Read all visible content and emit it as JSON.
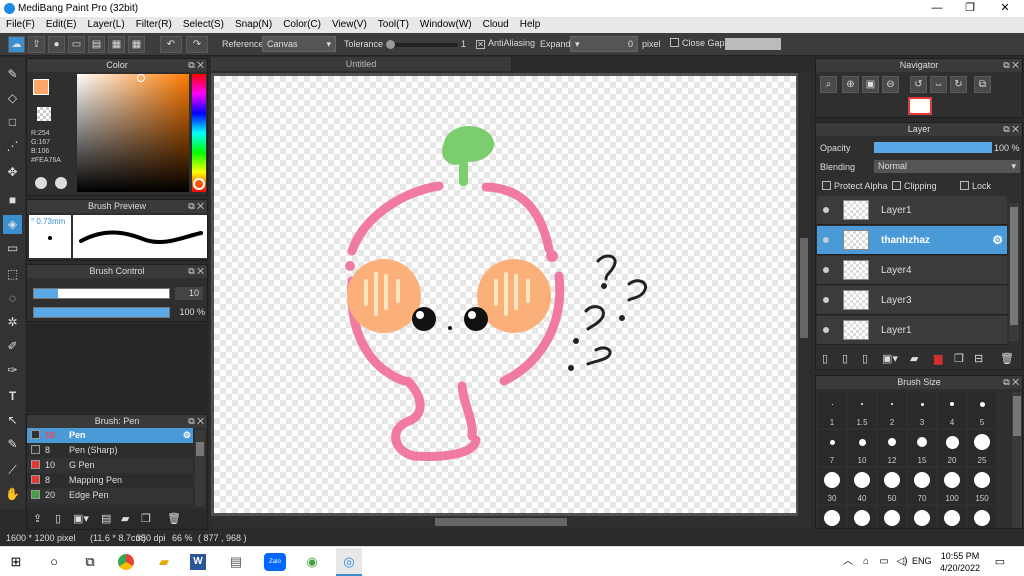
{
  "window": {
    "title": "MediBang Paint Pro (32bit)",
    "minimize": "—",
    "maximize": "❐",
    "close": "✕"
  },
  "menu": [
    "File(F)",
    "Edit(E)",
    "Layer(L)",
    "Filter(R)",
    "Select(S)",
    "Snap(N)",
    "Color(C)",
    "View(V)",
    "Tool(T)",
    "Window(W)",
    "Cloud",
    "Help"
  ],
  "toolbar": {
    "reference_label": "Reference",
    "reference_value": "Canvas",
    "tolerance_label": "Tolerance",
    "tolerance_value": "1",
    "antialiasing_label": "AntiAliasing",
    "antialiasing_checked": "✕",
    "expand_label": "Expand",
    "expand_value": "0",
    "expand_unit": "pixel",
    "close_gaps_label": "Close Gaps"
  },
  "color_panel": {
    "title": "Color",
    "r": "R:254",
    "g": "G:167",
    "b": "B:106",
    "hex": "#FEA76A",
    "primary_color": "#FEA76A"
  },
  "brush_preview": {
    "title": "Brush Preview",
    "size": "° 0.73mm"
  },
  "brush_control": {
    "title": "Brush Control",
    "size_value": "10",
    "opacity_value": "100 %",
    "size_fraction": 0.18,
    "opacity_fraction": 1.0
  },
  "brush_list": {
    "title": "Brush: Pen",
    "items": [
      {
        "size": "10",
        "name": "Pen",
        "color": "#333333",
        "selected": true
      },
      {
        "size": "8",
        "name": "Pen (Sharp)",
        "color": "#333333"
      },
      {
        "size": "10",
        "name": "G Pen",
        "color": "#e53935"
      },
      {
        "size": "8",
        "name": "Mapping Pen",
        "color": "#e53935"
      },
      {
        "size": "20",
        "name": "Edge Pen",
        "color": "#43a047"
      }
    ]
  },
  "canvas": {
    "tab": "Untitled"
  },
  "navigator": {
    "title": "Navigator"
  },
  "layer_panel": {
    "title": "Layer",
    "opacity_label": "Opacity",
    "opacity_value": "100 %",
    "opacity_fraction": 1.0,
    "blending_label": "Blending",
    "blending_value": "Normal",
    "protect_alpha": "Protect Alpha",
    "clipping": "Clipping",
    "lock": "Lock",
    "layers": [
      {
        "name": "Layer1"
      },
      {
        "name": "thanhzhaz",
        "selected": true
      },
      {
        "name": "Layer4"
      },
      {
        "name": "Layer3"
      },
      {
        "name": "Layer1"
      }
    ]
  },
  "brush_size": {
    "title": "Brush Size",
    "rows": [
      [
        "1",
        "1.5",
        "2",
        "3",
        "4",
        "5"
      ],
      [
        "7",
        "10",
        "12",
        "15",
        "20",
        "25"
      ],
      [
        "30",
        "40",
        "50",
        "70",
        "100",
        "150"
      ],
      [
        "",
        "",
        "",
        "",
        "",
        ""
      ]
    ]
  },
  "status": {
    "dimensions": "1600 * 1200 pixel",
    "physical": "(11.6 * 8.7cm)",
    "dpi": "350 dpi",
    "zoom": "66 %",
    "coords": "( 877 , 968 )"
  },
  "taskbar": {
    "time": "10:55 PM",
    "date": "4/20/2022",
    "lang": "ENG"
  }
}
